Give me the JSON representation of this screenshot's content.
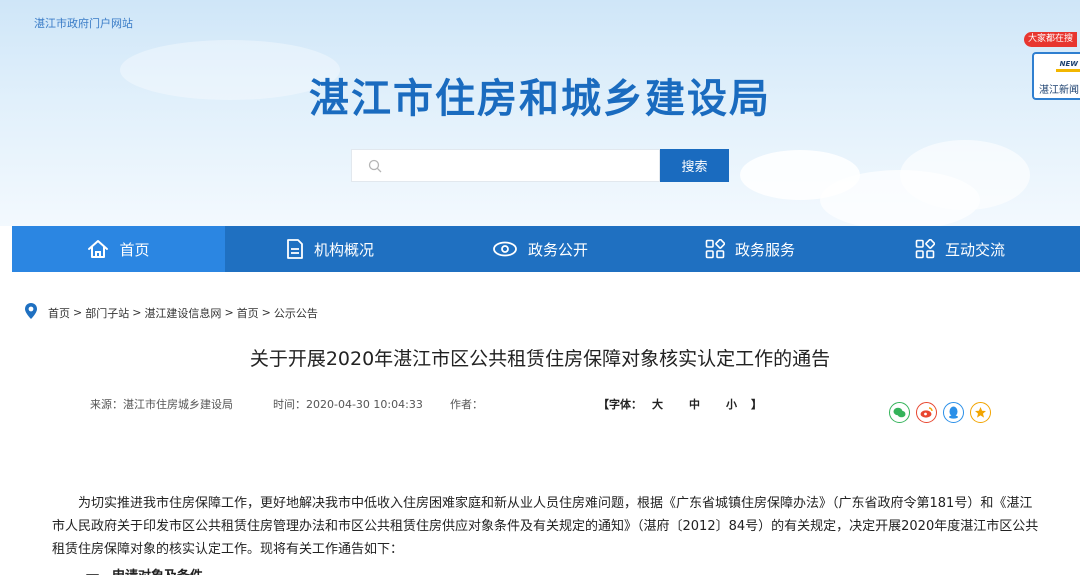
{
  "header": {
    "portal_link": "湛江市政府门户网站",
    "site_title": "湛江市住房和城乡建设局",
    "search": {
      "placeholder": "",
      "button_label": "搜索"
    }
  },
  "widget": {
    "badge": "大家都在搜",
    "new_tag": "NEW",
    "news_label": "湛江新闻"
  },
  "nav": {
    "items": [
      {
        "label": "首页",
        "icon": "home-icon",
        "active": true
      },
      {
        "label": "机构概况",
        "icon": "document-icon",
        "active": false
      },
      {
        "label": "政务公开",
        "icon": "eye-icon",
        "active": false
      },
      {
        "label": "政务服务",
        "icon": "grid-icon",
        "active": false
      },
      {
        "label": "互动交流",
        "icon": "grid-icon",
        "active": false
      }
    ]
  },
  "breadcrumb": {
    "items": [
      "首页",
      "部门子站",
      "湛江建设信息网",
      "首页",
      "公示公告"
    ],
    "separator": ">"
  },
  "article": {
    "title": "关于开展2020年湛江市区公共租赁住房保障对象核实认定工作的通告",
    "source": "来源：湛江市住房城乡建设局",
    "time": "时间：2020-04-30 10:04:33",
    "author": "作者：",
    "font_label": "【字体：",
    "font_large": "大",
    "font_medium": "中",
    "font_small": "小",
    "font_close": "】",
    "paragraph1": "为切实推进我市住房保障工作，更好地解决我市中低收入住房困难家庭和新从业人员住房难问题，根据《广东省城镇住房保障办法》（广东省政府令第181号）和《湛江市人民政府关于印发市区公共租赁住房管理办法和市区公共租赁住房供应对象条件及有关规定的通知》（湛府〔2012〕84号）的有关规定，决定开展2020年度湛江市区公共租赁住房保障对象的核实认定工作。现将有关工作通告如下：",
    "section1": "一、申请对象及条件"
  },
  "colors": {
    "primary": "#1f70c1",
    "nav_active": "#2b86e2",
    "title_blue": "#1a6bbf",
    "wechat": "#34b35a",
    "weibo": "#e8462f",
    "qq": "#2a8fe8",
    "qzone": "#f2a400"
  }
}
